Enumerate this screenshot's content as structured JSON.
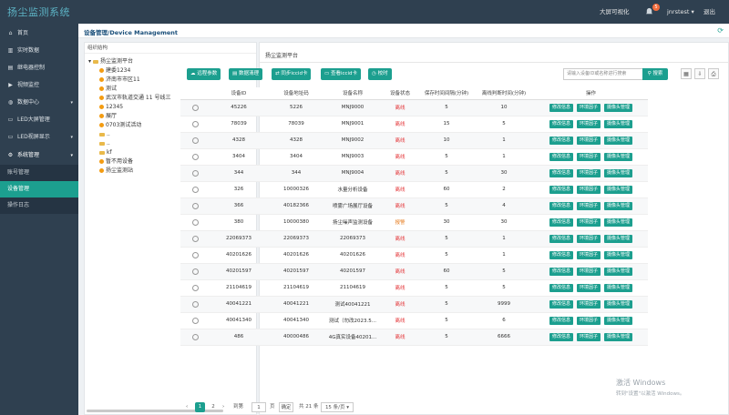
{
  "app": {
    "title": "扬尘监测系统"
  },
  "topbar": {
    "screen_link": "大屏可视化",
    "notification_count": "5",
    "user": "jnrstest",
    "logout": "退出"
  },
  "sidebar": {
    "items": [
      {
        "label": "首页",
        "icon": "home-icon"
      },
      {
        "label": "实时数据",
        "icon": "chart-icon"
      },
      {
        "label": "继电器控制",
        "icon": "relay-icon"
      },
      {
        "label": "视频监控",
        "icon": "video-icon"
      },
      {
        "label": "数据中心",
        "icon": "database-icon"
      },
      {
        "label": "LED大屏管理",
        "icon": "monitor-icon"
      },
      {
        "label": "LED视屏显示",
        "icon": "display-icon"
      },
      {
        "label": "系统管理",
        "icon": "gear-icon"
      },
      {
        "label": "账号管理",
        "icon": ""
      },
      {
        "label": "设备管理",
        "icon": ""
      },
      {
        "label": "操作日志",
        "icon": ""
      }
    ]
  },
  "breadcrumb": "设备管理/Device Management",
  "tree": {
    "header": "组织结构",
    "nodes": [
      {
        "label": "扬尘监测平台",
        "type": "folder"
      },
      {
        "label": "建委1234",
        "type": "dot"
      },
      {
        "label": "济南市市区11",
        "type": "dot"
      },
      {
        "label": "测试",
        "type": "dot"
      },
      {
        "label": "武汉市轨道交通 11 号线三",
        "type": "dot"
      },
      {
        "label": "12345",
        "type": "dot"
      },
      {
        "label": "展厅",
        "type": "dot"
      },
      {
        "label": "0703测试活动",
        "type": "dot"
      },
      {
        "label": "..",
        "type": "folder"
      },
      {
        "label": "..",
        "type": "folder"
      },
      {
        "label": "kf",
        "type": "folder"
      },
      {
        "label": "暂不用设备",
        "type": "dot"
      },
      {
        "label": "扬尘监测站",
        "type": "dot"
      }
    ]
  },
  "panel": {
    "title": "扬尘监测平台"
  },
  "toolbar": {
    "buttons": [
      "远程参数",
      "数据清理",
      "同步iccid卡",
      "查看iccid卡",
      "校时"
    ],
    "search_placeholder": "请输入设备ID或名称进行搜索",
    "search_button": "搜索"
  },
  "table": {
    "headers": [
      "",
      "设备ID",
      "设备地址码",
      "设备名称",
      "设备状态",
      "保存时间间隔(分钟)",
      "离线判断时间(分钟)",
      "操作"
    ],
    "action_labels": [
      "修改信息",
      "环境因子",
      "摄像头管理"
    ],
    "rows": [
      [
        "45226",
        "5226",
        "MNJ9000",
        "离线",
        "5",
        "10"
      ],
      [
        "78039",
        "78039",
        "MNJ9001",
        "离线",
        "15",
        "5"
      ],
      [
        "4328",
        "4328",
        "MNJ9002",
        "离线",
        "10",
        "1"
      ],
      [
        "3404",
        "3404",
        "MNJ9003",
        "离线",
        "5",
        "1"
      ],
      [
        "344",
        "344",
        "MNJ9004",
        "离线",
        "5",
        "30"
      ],
      [
        "326",
        "10000326",
        "水量分析设备",
        "离线",
        "60",
        "2"
      ],
      [
        "366",
        "40182366",
        "喷雾广场展厅设备",
        "离线",
        "5",
        "4"
      ],
      [
        "380",
        "10000380",
        "扬尘噪声监测设备",
        "报警",
        "30",
        "30"
      ],
      [
        "22069373",
        "22069373",
        "22069373",
        "离线",
        "5",
        "1"
      ],
      [
        "40201626",
        "40201626",
        "40201626",
        "离线",
        "5",
        "1"
      ],
      [
        "40201597",
        "40201597",
        "40201597",
        "离线",
        "60",
        "5"
      ],
      [
        "21104619",
        "21104619",
        "21104619",
        "离线",
        "5",
        "5"
      ],
      [
        "40041221",
        "40041221",
        "测试40041221",
        "离线",
        "5",
        "9999"
      ],
      [
        "40041340",
        "40041340",
        "测试（勿改2023.5...",
        "离线",
        "5",
        "6"
      ],
      [
        "486",
        "40000486",
        "4G真实设备40201...",
        "离线",
        "5",
        "6666"
      ]
    ]
  },
  "pager": {
    "current": "1",
    "next": "2",
    "goto_label": "到第",
    "goto_value": "1",
    "page_label": "页",
    "confirm": "确定",
    "total": "共 21 条",
    "per_page": "15 条/页"
  },
  "watermark": {
    "line1": "激活 Windows",
    "line2": "转到\"设置\"以激活 Windows。"
  },
  "colors": {
    "sidebar": "#2f4050",
    "accent": "#1c9f8f",
    "status_offline": "#e4393c",
    "status_alarm": "#e67e22"
  }
}
